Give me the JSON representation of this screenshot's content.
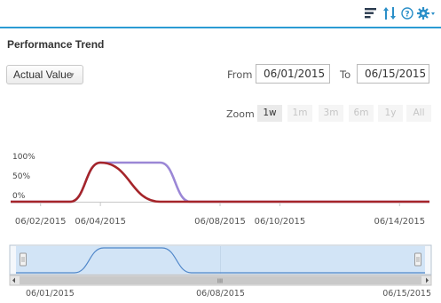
{
  "toolbar": {
    "icons": [
      "list-icon",
      "sort-icon",
      "help-icon",
      "gear-icon"
    ],
    "accent_color": "#2b9bd3"
  },
  "page": {
    "title": "Performance Trend"
  },
  "controls": {
    "measure_select": "Actual Value",
    "from_label": "From",
    "from_value": "06/01/2015",
    "to_label": "To",
    "to_value": "06/15/2015"
  },
  "zoom": {
    "label": "Zoom",
    "options": [
      "1w",
      "1m",
      "3m",
      "6m",
      "1y",
      "All"
    ],
    "active": "1w"
  },
  "chart_data": {
    "type": "line",
    "x_range": [
      "2015-06-01",
      "2015-06-15"
    ],
    "visible_x_range": [
      "2015-06-01",
      "2015-06-15"
    ],
    "y_ticks": [
      "100%",
      "50%",
      "0%"
    ],
    "ylim": [
      0,
      100
    ],
    "x_tick_labels": [
      "06/02/2015",
      "06/04/2015",
      "06/08/2015",
      "06/10/2015",
      "06/14/2015"
    ],
    "grid": false,
    "legend": "none",
    "series": [
      {
        "color": "#9b87d6",
        "x": [
          "2015-06-01",
          "2015-06-03",
          "2015-06-04",
          "2015-06-05",
          "2015-06-06",
          "2015-06-07",
          "2015-06-15"
        ],
        "values": [
          0,
          0,
          100,
          100,
          100,
          0,
          0
        ]
      },
      {
        "color": "#a5252a",
        "x": [
          "2015-06-01",
          "2015-06-03",
          "2015-06-04",
          "2015-06-06",
          "2015-06-15"
        ],
        "values": [
          0,
          0,
          100,
          0,
          0
        ]
      }
    ]
  },
  "navigator": {
    "labels": [
      "06/01/2015",
      "06/08/2015",
      "06/15/2015"
    ],
    "scroll_grip": "III",
    "selection": [
      "2015-06-01",
      "2015-06-15"
    ]
  }
}
